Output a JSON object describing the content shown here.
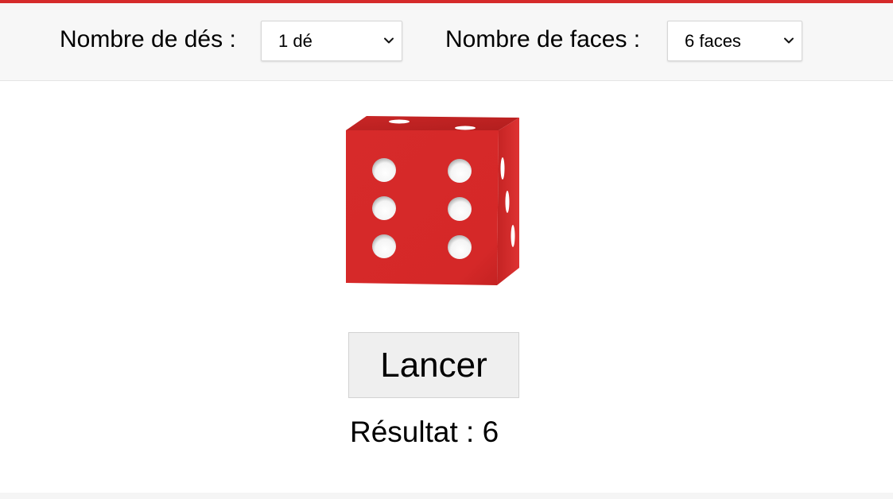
{
  "controls": {
    "dice_count_label": "Nombre de dés :",
    "dice_count_value": "1 dé",
    "faces_label": "Nombre de faces :",
    "faces_value": "6 faces"
  },
  "die": {
    "face_value": 6,
    "color": "#d52a2a"
  },
  "actions": {
    "roll_label": "Lancer"
  },
  "result": {
    "text": "Résultat : 6"
  },
  "theme": {
    "accent": "#d52a2a",
    "toolbar_bg": "#f7f7f7"
  },
  "icons": {
    "select_chevron": "chevron-down-icon"
  }
}
